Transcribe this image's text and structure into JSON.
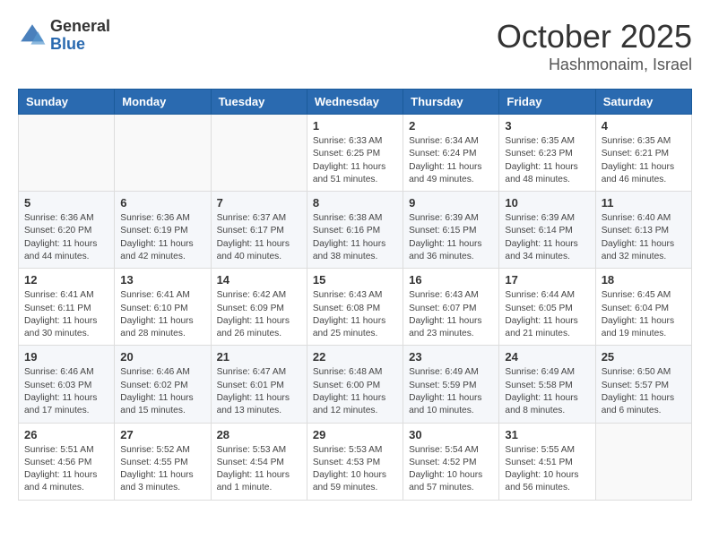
{
  "header": {
    "logo_general": "General",
    "logo_blue": "Blue",
    "month": "October 2025",
    "location": "Hashmonaim, Israel"
  },
  "weekdays": [
    "Sunday",
    "Monday",
    "Tuesday",
    "Wednesday",
    "Thursday",
    "Friday",
    "Saturday"
  ],
  "weeks": [
    [
      {
        "day": "",
        "info": ""
      },
      {
        "day": "",
        "info": ""
      },
      {
        "day": "",
        "info": ""
      },
      {
        "day": "1",
        "info": "Sunrise: 6:33 AM\nSunset: 6:25 PM\nDaylight: 11 hours\nand 51 minutes."
      },
      {
        "day": "2",
        "info": "Sunrise: 6:34 AM\nSunset: 6:24 PM\nDaylight: 11 hours\nand 49 minutes."
      },
      {
        "day": "3",
        "info": "Sunrise: 6:35 AM\nSunset: 6:23 PM\nDaylight: 11 hours\nand 48 minutes."
      },
      {
        "day": "4",
        "info": "Sunrise: 6:35 AM\nSunset: 6:21 PM\nDaylight: 11 hours\nand 46 minutes."
      }
    ],
    [
      {
        "day": "5",
        "info": "Sunrise: 6:36 AM\nSunset: 6:20 PM\nDaylight: 11 hours\nand 44 minutes."
      },
      {
        "day": "6",
        "info": "Sunrise: 6:36 AM\nSunset: 6:19 PM\nDaylight: 11 hours\nand 42 minutes."
      },
      {
        "day": "7",
        "info": "Sunrise: 6:37 AM\nSunset: 6:17 PM\nDaylight: 11 hours\nand 40 minutes."
      },
      {
        "day": "8",
        "info": "Sunrise: 6:38 AM\nSunset: 6:16 PM\nDaylight: 11 hours\nand 38 minutes."
      },
      {
        "day": "9",
        "info": "Sunrise: 6:39 AM\nSunset: 6:15 PM\nDaylight: 11 hours\nand 36 minutes."
      },
      {
        "day": "10",
        "info": "Sunrise: 6:39 AM\nSunset: 6:14 PM\nDaylight: 11 hours\nand 34 minutes."
      },
      {
        "day": "11",
        "info": "Sunrise: 6:40 AM\nSunset: 6:13 PM\nDaylight: 11 hours\nand 32 minutes."
      }
    ],
    [
      {
        "day": "12",
        "info": "Sunrise: 6:41 AM\nSunset: 6:11 PM\nDaylight: 11 hours\nand 30 minutes."
      },
      {
        "day": "13",
        "info": "Sunrise: 6:41 AM\nSunset: 6:10 PM\nDaylight: 11 hours\nand 28 minutes."
      },
      {
        "day": "14",
        "info": "Sunrise: 6:42 AM\nSunset: 6:09 PM\nDaylight: 11 hours\nand 26 minutes."
      },
      {
        "day": "15",
        "info": "Sunrise: 6:43 AM\nSunset: 6:08 PM\nDaylight: 11 hours\nand 25 minutes."
      },
      {
        "day": "16",
        "info": "Sunrise: 6:43 AM\nSunset: 6:07 PM\nDaylight: 11 hours\nand 23 minutes."
      },
      {
        "day": "17",
        "info": "Sunrise: 6:44 AM\nSunset: 6:05 PM\nDaylight: 11 hours\nand 21 minutes."
      },
      {
        "day": "18",
        "info": "Sunrise: 6:45 AM\nSunset: 6:04 PM\nDaylight: 11 hours\nand 19 minutes."
      }
    ],
    [
      {
        "day": "19",
        "info": "Sunrise: 6:46 AM\nSunset: 6:03 PM\nDaylight: 11 hours\nand 17 minutes."
      },
      {
        "day": "20",
        "info": "Sunrise: 6:46 AM\nSunset: 6:02 PM\nDaylight: 11 hours\nand 15 minutes."
      },
      {
        "day": "21",
        "info": "Sunrise: 6:47 AM\nSunset: 6:01 PM\nDaylight: 11 hours\nand 13 minutes."
      },
      {
        "day": "22",
        "info": "Sunrise: 6:48 AM\nSunset: 6:00 PM\nDaylight: 11 hours\nand 12 minutes."
      },
      {
        "day": "23",
        "info": "Sunrise: 6:49 AM\nSunset: 5:59 PM\nDaylight: 11 hours\nand 10 minutes."
      },
      {
        "day": "24",
        "info": "Sunrise: 6:49 AM\nSunset: 5:58 PM\nDaylight: 11 hours\nand 8 minutes."
      },
      {
        "day": "25",
        "info": "Sunrise: 6:50 AM\nSunset: 5:57 PM\nDaylight: 11 hours\nand 6 minutes."
      }
    ],
    [
      {
        "day": "26",
        "info": "Sunrise: 5:51 AM\nSunset: 4:56 PM\nDaylight: 11 hours\nand 4 minutes."
      },
      {
        "day": "27",
        "info": "Sunrise: 5:52 AM\nSunset: 4:55 PM\nDaylight: 11 hours\nand 3 minutes."
      },
      {
        "day": "28",
        "info": "Sunrise: 5:53 AM\nSunset: 4:54 PM\nDaylight: 11 hours\nand 1 minute."
      },
      {
        "day": "29",
        "info": "Sunrise: 5:53 AM\nSunset: 4:53 PM\nDaylight: 10 hours\nand 59 minutes."
      },
      {
        "day": "30",
        "info": "Sunrise: 5:54 AM\nSunset: 4:52 PM\nDaylight: 10 hours\nand 57 minutes."
      },
      {
        "day": "31",
        "info": "Sunrise: 5:55 AM\nSunset: 4:51 PM\nDaylight: 10 hours\nand 56 minutes."
      },
      {
        "day": "",
        "info": ""
      }
    ]
  ]
}
